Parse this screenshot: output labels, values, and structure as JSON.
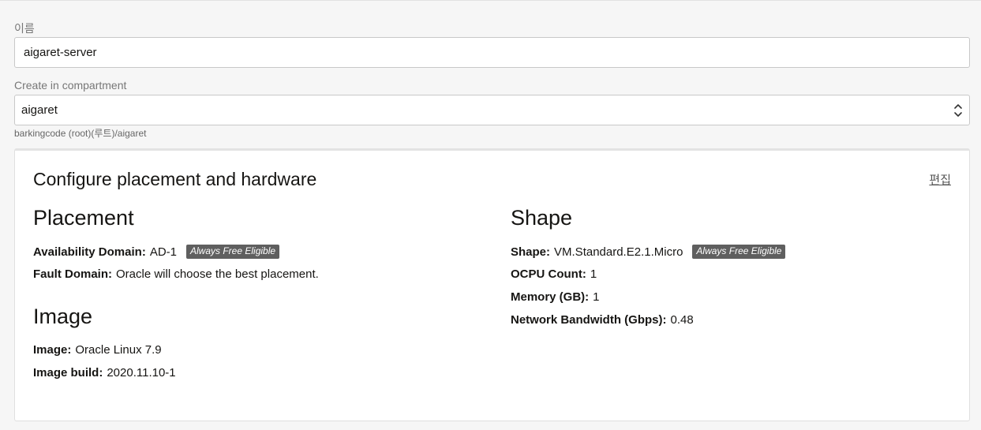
{
  "form": {
    "name_label": "이름",
    "name_value": "aigaret-server",
    "compartment_label": "Create in compartment",
    "compartment_value": "aigaret",
    "compartment_path": "barkingcode (root)(루트)/aigaret"
  },
  "panel": {
    "title": "Configure placement and hardware",
    "edit_label": "편집",
    "placement": {
      "title": "Placement",
      "availability_domain_key": "Availability Domain:",
      "availability_domain_value": "AD-1",
      "availability_badge": "Always Free Eligible",
      "fault_domain_key": "Fault Domain:",
      "fault_domain_value": "Oracle will choose the best placement."
    },
    "image": {
      "title": "Image",
      "image_key": "Image:",
      "image_value": "Oracle Linux 7.9",
      "build_key": "Image build:",
      "build_value": "2020.11.10-1"
    },
    "shape": {
      "title": "Shape",
      "shape_key": "Shape:",
      "shape_value": "VM.Standard.E2.1.Micro",
      "shape_badge": "Always Free Eligible",
      "ocpu_key": "OCPU Count:",
      "ocpu_value": "1",
      "memory_key": "Memory (GB):",
      "memory_value": "1",
      "bandwidth_key": "Network Bandwidth (Gbps):",
      "bandwidth_value": "0.48"
    }
  },
  "icons": {
    "select_arrows": "chevron-up-down-icon"
  }
}
